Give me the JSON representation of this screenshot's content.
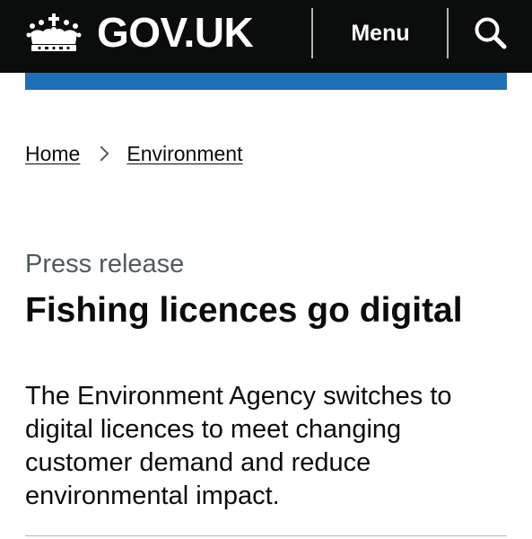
{
  "header": {
    "logo_text": "GOV.UK",
    "menu_label": "Menu",
    "search_icon": "search-icon",
    "crown_icon": "crown-icon",
    "background_color": "#0b0c0c",
    "accent_bar_color": "#1d70b8"
  },
  "breadcrumb": {
    "items": [
      {
        "label": "Home"
      },
      {
        "label": "Environment"
      }
    ],
    "separator_icon": "chevron-right-icon"
  },
  "article": {
    "caption": "Press release",
    "title": "Fishing licences go digital",
    "lede": "The Environment Agency switches to digital licences to meet changing customer demand and reduce environmental impact."
  }
}
